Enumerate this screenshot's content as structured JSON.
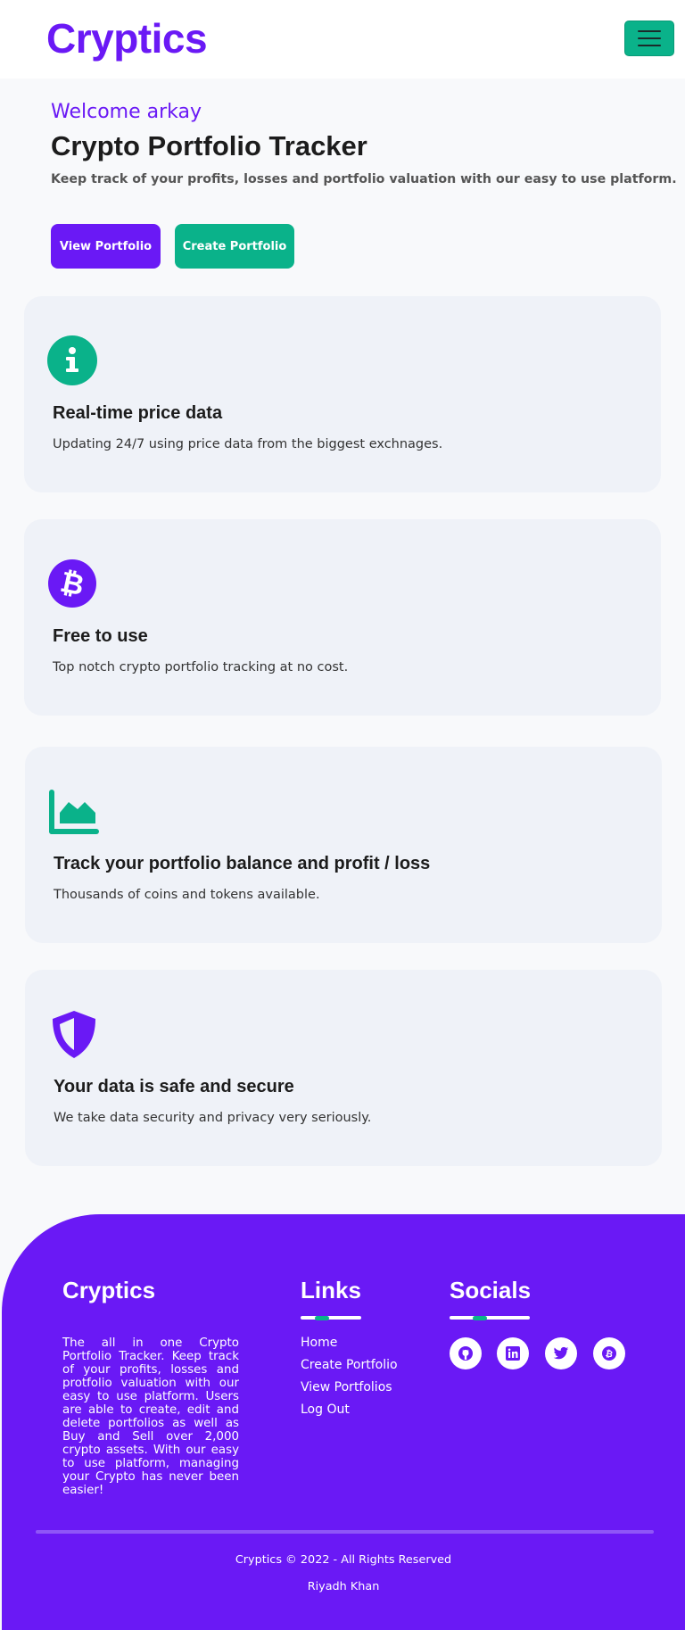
{
  "navbar": {
    "brand": "Cryptics",
    "menu_icon": "hamburger-icon",
    "menu_color": "#0ab28a"
  },
  "hero": {
    "welcome": "Welcome arkay",
    "title": "Crypto Portfolio Tracker",
    "subtitle": "Keep track of your profits, losses and portfolio valuation with our easy to use platform.",
    "view_button": "View Portfolio",
    "create_button": "Create Portfolio"
  },
  "features": [
    {
      "icon": "info-icon",
      "title": "Real-time price data",
      "text": "Updating 24/7 using price data from the biggest exchnages."
    },
    {
      "icon": "bitcoin-icon",
      "title": "Free to use",
      "text": "Top notch crypto portfolio tracking at no cost."
    },
    {
      "icon": "area-chart-icon",
      "title": "Track your portfolio balance and profit / loss",
      "text": "Thousands of coins and tokens available."
    },
    {
      "icon": "shield-icon",
      "title": "Your data is safe and secure",
      "text": "We take data security and privacy very seriously."
    }
  ],
  "footer": {
    "brand": "Cryptics",
    "about": "The all in one Crypto Portfolio Tracker. Keep track of your profits, losses and protfolio valuation with our easy to use platform. Users are able to create, edit and delete portfolios as well as Buy and Sell over 2,000 crypto assets. With our easy to use platform, managing your Crypto has never been easier!",
    "links_title": "Links",
    "links": [
      "Home",
      "Create Portfolio",
      "View Portfolios",
      "Log Out"
    ],
    "socials_title": "Socials",
    "socials": [
      "github-icon",
      "linkedin-icon",
      "twitter-icon",
      "bitcoin-icon"
    ],
    "copyright": "Cryptics © 2022 - All Rights Reserved",
    "author": "Riyadh Khan"
  },
  "colors": {
    "brand_purple": "#6a19f5",
    "brand_green": "#0ab28a",
    "card_bg": "#eff2f8"
  }
}
